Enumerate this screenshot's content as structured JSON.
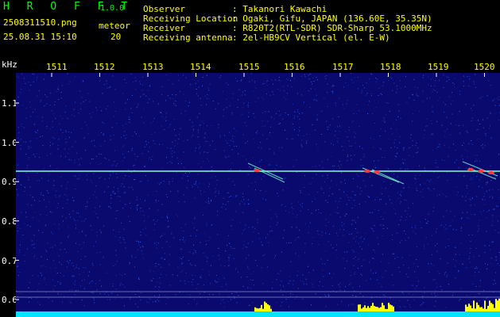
{
  "header": {
    "app_title": "H R O F F T",
    "version": "1.0.0",
    "filename": "2508311510.png",
    "datetime": "25.08.31 15:10",
    "meteor_label": "meteor",
    "meteor_count": "20",
    "info_labels": [
      "Observer",
      "Receiving Location",
      "Receiver",
      "Receiving antenna"
    ],
    "info_values": [
      ": Takanori Kawachi",
      ": Ogaki, Gifu, JAPAN (136.60E, 35.35N)",
      ": R820T2(RTL-SDR) SDR-Sharp 53.1000MHz",
      ": 2el-HB9CV Vertical (el. E-W)"
    ]
  },
  "spectrogram": {
    "y_unit": "kHz",
    "y_ticks": [
      "1.1",
      "1.0",
      "0.9",
      "0.8",
      "0.7",
      "0.6"
    ],
    "x_ticks": [
      "1511",
      "1512",
      "1513",
      "1514",
      "1515",
      "1516",
      "1517",
      "1518",
      "1519",
      "1520"
    ],
    "colors": {
      "background": "#0a0a6e",
      "noise": "#3a6bff",
      "carrier": "#7fffd4",
      "meteor": "#ff3b3b",
      "bottom_bar": "#00e5ff",
      "bottom_peak": "#ffff00"
    }
  }
}
